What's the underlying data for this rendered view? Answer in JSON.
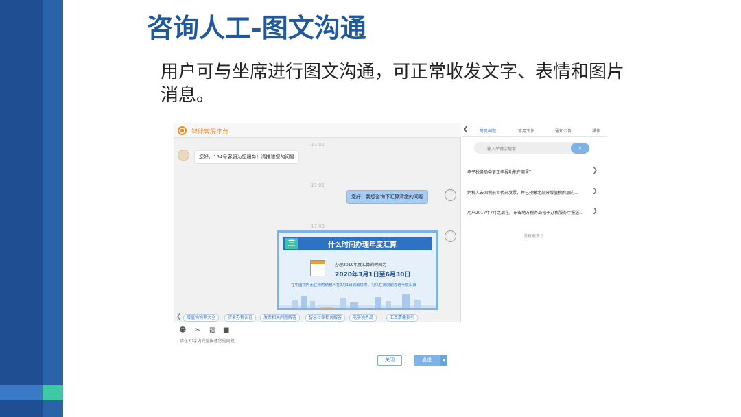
{
  "slide": {
    "title": "咨询人工-图文沟通",
    "subtitle": "用户可与坐席进行图文沟通，可正常收发文字、表情和图片消息。"
  },
  "app": {
    "title": "智能客服平台"
  },
  "chat": {
    "timestamps": [
      "17:02",
      "17:02",
      "17:03"
    ],
    "messages": [
      {
        "from": "agent",
        "text": "您好，154号客服为您服务！请描述您的问题"
      },
      {
        "from": "user",
        "text": "您好，我想咨询下汇算清缴的问题"
      }
    ],
    "image_card": {
      "header_icon": "三",
      "header": "什么时间办理年度汇算",
      "line1": "办理2019年度汇算的时间为",
      "line2": "2020年3月1日至6月30日",
      "line3": "在中国境内无住所的纳税人在3月1日前离境的，可以在离境前办理年度汇算"
    }
  },
  "quick_replies": [
    "增值税税率大全",
    "实名办税认证",
    "发票相关问题解答",
    "智慧社保相关解答",
    "电子税务局",
    "汇算清缴指引"
  ],
  "tools": {
    "emoji_icon": "☻",
    "scissors_icon": "✂",
    "image_icon": "▧",
    "folder_icon": "■"
  },
  "input": {
    "hint": "请在30字内完整描述您的问题。"
  },
  "buttons": {
    "close": "关闭",
    "send": "发送",
    "send_dropdown": "▼"
  },
  "right_panel": {
    "tabs": [
      "常见问题",
      "常用文件",
      "通知公告",
      "操作"
    ],
    "active_tab": 0,
    "search_placeholder": "输入关键字搜索",
    "search_icon": "⌕",
    "faqs": [
      "电子税务局中更正申报功能在哪里？",
      "纳税人去国税前台代开发票，并已预缴北部分增值税附加的…",
      "用户2017年7月之后在广东省地方税务局电子办税服务厅报送…"
    ],
    "more": "没有更多了"
  },
  "colors": {
    "brand_blue": "#1f5a9e",
    "accent_orange": "#f08a23",
    "bubble_blue": "#a8cdf2",
    "sidebar": "#2b63a8",
    "green": "#3dc9a4"
  }
}
